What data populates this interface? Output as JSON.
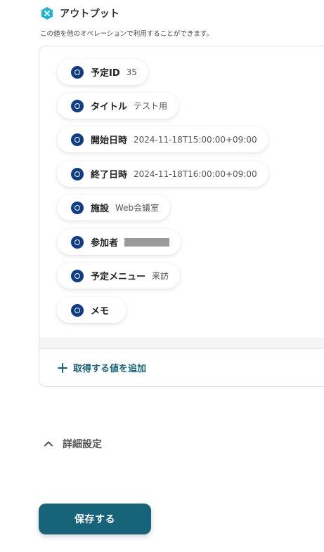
{
  "section": {
    "title": "アウトプット",
    "description": "この値を他のオペレーションで利用することができます。",
    "icon": "output-icon"
  },
  "outputs": [
    {
      "label": "予定ID",
      "value": "35",
      "icon": "calendar-service-icon"
    },
    {
      "label": "タイトル",
      "value": "テスト用",
      "icon": "calendar-service-icon"
    },
    {
      "label": "開始日時",
      "value": "2024-11-18T15:00:00+09:00",
      "icon": "calendar-service-icon"
    },
    {
      "label": "終了日時",
      "value": "2024-11-18T16:00:00+09:00",
      "icon": "calendar-service-icon"
    },
    {
      "label": "施設",
      "value": "Web会議室",
      "icon": "calendar-service-icon"
    },
    {
      "label": "参加者",
      "value": "",
      "masked": true,
      "icon": "calendar-service-icon"
    },
    {
      "label": "予定メニュー",
      "value": "来訪",
      "icon": "calendar-service-icon"
    },
    {
      "label": "メモ",
      "value": "",
      "icon": "calendar-service-icon"
    }
  ],
  "add_value": {
    "label": "取得する値を追加",
    "icon": "plus-icon"
  },
  "details": {
    "label": "詳細設定",
    "icon": "chevron-up-icon"
  },
  "save": {
    "label": "保存する"
  },
  "colors": {
    "accent": "#17637a",
    "service_icon": "#0e3d8c",
    "section_icon": "#1fb5d9"
  }
}
